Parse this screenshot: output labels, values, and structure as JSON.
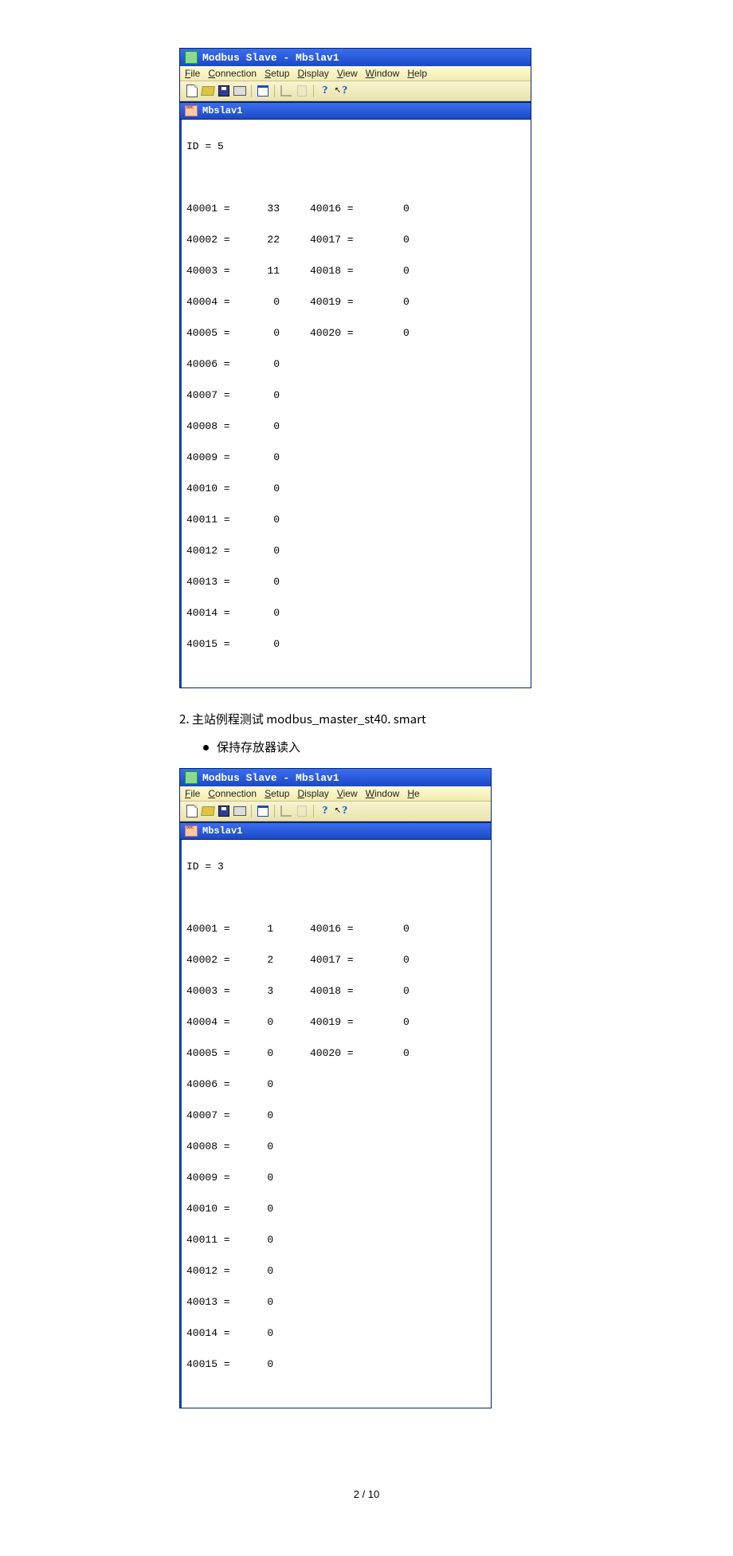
{
  "window1": {
    "title": "Modbus Slave - Mbslav1",
    "menus": [
      "File",
      "Connection",
      "Setup",
      "Display",
      "View",
      "Window",
      "Help"
    ],
    "docTitle": "Mbslav1",
    "idLine": "ID = 5",
    "rows": [
      {
        "a": "40001 =      33",
        "b": "40016 =        0"
      },
      {
        "a": "40002 =      22",
        "b": "40017 =        0"
      },
      {
        "a": "40003 =      11",
        "b": "40018 =        0"
      },
      {
        "a": "40004 =       0",
        "b": "40019 =        0"
      },
      {
        "a": "40005 =       0",
        "b": "40020 =        0"
      },
      {
        "a": "40006 =       0",
        "b": ""
      },
      {
        "a": "40007 =       0",
        "b": ""
      },
      {
        "a": "40008 =       0",
        "b": ""
      },
      {
        "a": "40009 =       0",
        "b": ""
      },
      {
        "a": "40010 =       0",
        "b": ""
      },
      {
        "a": "40011 =       0",
        "b": ""
      },
      {
        "a": "40012 =       0",
        "b": ""
      },
      {
        "a": "40013 =       0",
        "b": ""
      },
      {
        "a": "40014 =       0",
        "b": ""
      },
      {
        "a": "40015 =       0",
        "b": ""
      }
    ]
  },
  "docLine2": "2.  主站例程测试 modbus_master_st40. smart",
  "bullet": "保持存放器读入",
  "window2": {
    "title": "Modbus Slave - Mbslav1",
    "menus": [
      "File",
      "Connection",
      "Setup",
      "Display",
      "View",
      "Window",
      "He"
    ],
    "docTitle": "Mbslav1",
    "idLine": "ID = 3",
    "rows": [
      {
        "a": "40001 =      1",
        "b": "40016 =        0"
      },
      {
        "a": "40002 =      2",
        "b": "40017 =        0"
      },
      {
        "a": "40003 =      3",
        "b": "40018 =        0"
      },
      {
        "a": "40004 =      0",
        "b": "40019 =        0"
      },
      {
        "a": "40005 =      0",
        "b": "40020 =        0"
      },
      {
        "a": "40006 =      0",
        "b": ""
      },
      {
        "a": "40007 =      0",
        "b": ""
      },
      {
        "a": "40008 =      0",
        "b": ""
      },
      {
        "a": "40009 =      0",
        "b": ""
      },
      {
        "a": "40010 =      0",
        "b": ""
      },
      {
        "a": "40011 =      0",
        "b": ""
      },
      {
        "a": "40012 =      0",
        "b": ""
      },
      {
        "a": "40013 =      0",
        "b": ""
      },
      {
        "a": "40014 =      0",
        "b": ""
      },
      {
        "a": "40015 =      0",
        "b": ""
      }
    ]
  },
  "footer": "2 / 10"
}
